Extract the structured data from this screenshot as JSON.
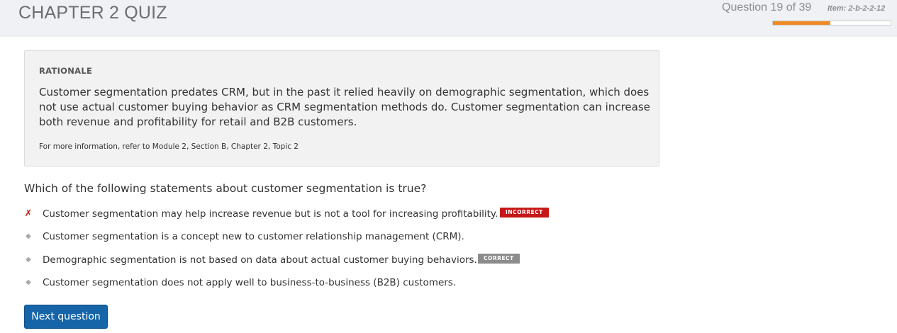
{
  "header": {
    "quiz_title": "CHAPTER 2 QUIZ",
    "question_counter": "Question 19 of 39",
    "item_id": "Item: 2-b-2-2-12",
    "progress_fraction": 0.487,
    "progress_color": "#f08a24"
  },
  "rationale": {
    "heading": "RATIONALE",
    "text": "Customer segmentation predates CRM, but in the past it relied heavily on demographic segmentation, which does not use actual customer buying behavior as CRM segmentation methods do. Customer segmentation can increase both revenue and profitability for retail and B2B customers.",
    "reference": "For more information, refer to Module 2, Section B, Chapter 2, Topic 2"
  },
  "question": {
    "text": "Which of the following statements about customer segmentation is true?"
  },
  "answers": [
    {
      "marker": "✗",
      "marker_icon": "x-mark-icon",
      "label": "Customer segmentation may help increase revenue but is not a tool for increasing profitability.",
      "badge": "INCORRECT"
    },
    {
      "marker": "◆",
      "marker_icon": "diamond-bullet-icon",
      "label": "Customer segmentation is a concept new to customer relationship management (CRM)."
    },
    {
      "marker": "◆",
      "marker_icon": "diamond-bullet-icon",
      "label": "Demographic segmentation is not based on data about actual customer buying behaviors.",
      "badge": "CORRECT"
    },
    {
      "marker": "◆",
      "marker_icon": "diamond-bullet-icon",
      "label": "Customer segmentation does not apply well to business-to-business (B2B) customers."
    }
  ],
  "colors": {
    "incorrect_badge": "#c61818",
    "correct_badge": "#8c8c8c",
    "primary_button": "#1565a8"
  },
  "next_button": {
    "label": "Next question"
  }
}
